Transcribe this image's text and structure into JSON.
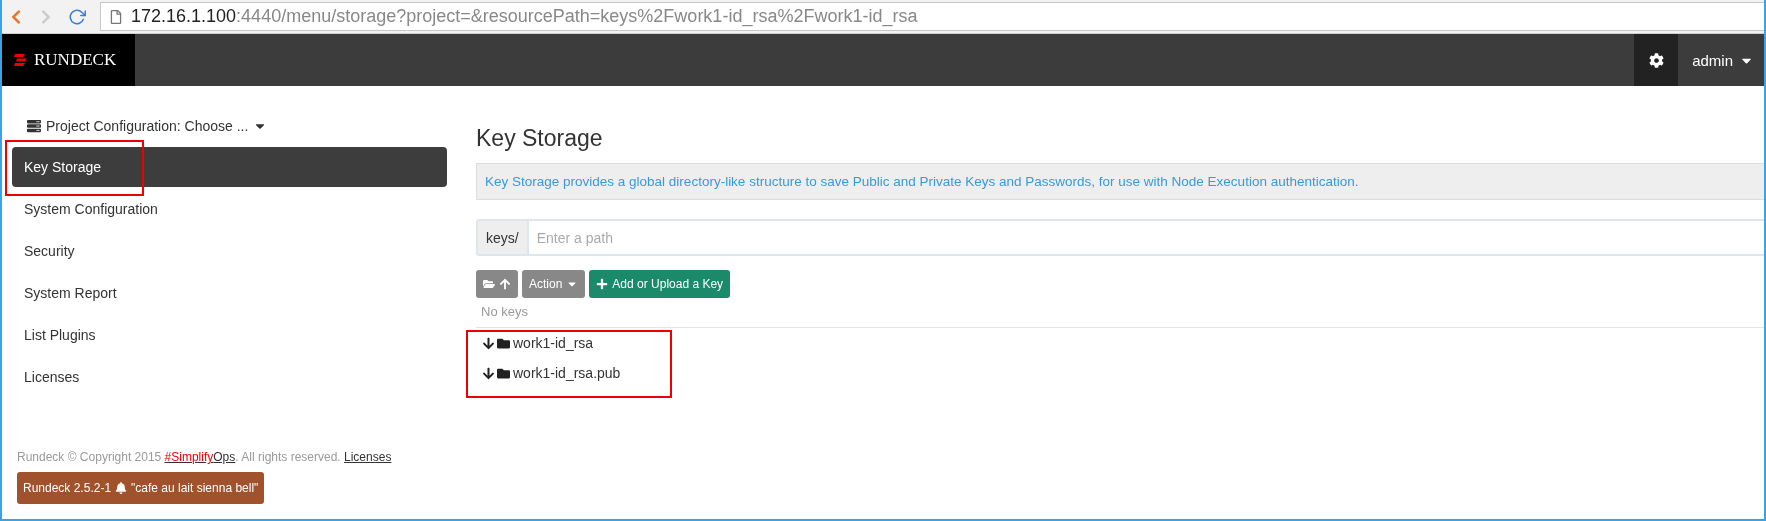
{
  "browser": {
    "url_host": "172.16.1.100",
    "url_rest": ":4440/menu/storage?project=&resourcePath=keys%2Fwork1-id_rsa%2Fwork1-id_rsa"
  },
  "navbar": {
    "brand": "RUNDECK",
    "user": "admin"
  },
  "sidebar": {
    "project_menu": "Project Configuration: Choose ...",
    "items": [
      {
        "label": "Key Storage",
        "selected": true,
        "highlighted": true
      },
      {
        "label": "System Configuration",
        "selected": false,
        "highlighted": false
      },
      {
        "label": "Security",
        "selected": false,
        "highlighted": false
      },
      {
        "label": "System Report",
        "selected": false,
        "highlighted": false
      },
      {
        "label": "List Plugins",
        "selected": false,
        "highlighted": false
      },
      {
        "label": "Licenses",
        "selected": false,
        "highlighted": false
      }
    ]
  },
  "footer": {
    "copyright": "Rundeck © Copyright 2015 ",
    "link_accent": "#Simplify",
    "link_rest": "Ops",
    "rights": ". All rights reserved. ",
    "licenses_link": "Licenses",
    "version_badge": "Rundeck 2.5.2-1",
    "release_name": "\"cafe au lait sienna bell\""
  },
  "main": {
    "title": "Key Storage",
    "description": "Key Storage provides a global directory-like structure to save Public and Private Keys and Passwords, for use with Node Execution authentication.",
    "path_prefix": "keys/",
    "path_placeholder": "Enter a path",
    "action_button": "Action",
    "add_button": "Add or Upload a Key",
    "empty_text": "No keys",
    "keys_highlighted": true,
    "keys": [
      {
        "name": "work1-id_rsa"
      },
      {
        "name": "work1-id_rsa.pub"
      }
    ]
  }
}
